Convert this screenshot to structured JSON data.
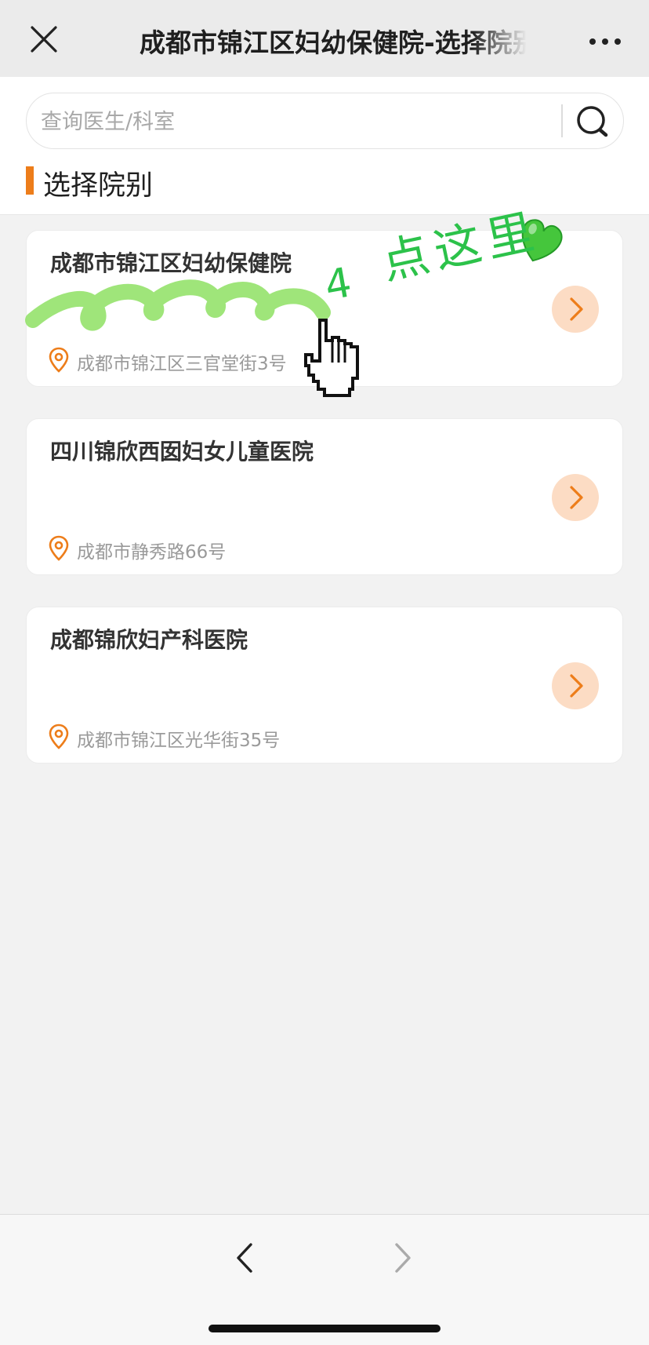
{
  "window": {
    "title": "成都市锦江区妇幼保健院-选择院别",
    "close_icon": "close-icon",
    "more_icon": "more-dots-icon"
  },
  "search": {
    "placeholder": "查询医生/科室",
    "value": "",
    "icon": "search-icon"
  },
  "section": {
    "title": "选择院别"
  },
  "hospitals": [
    {
      "name": "成都市锦江区妇幼保健院",
      "address": "成都市锦江区三官堂街3号"
    },
    {
      "name": "四川锦欣西囡妇女儿童医院",
      "address": "成都市静秀路66号"
    },
    {
      "name": "成都锦欣妇产科医院",
      "address": "成都市锦江区光华街35号"
    }
  ],
  "annotation": {
    "step_number": "4",
    "text": "点这里",
    "emoji": "💚",
    "color": "#2cc24a"
  },
  "bottom_nav": {
    "back_icon": "chevron-left-icon",
    "forward_icon": "chevron-right-icon"
  },
  "colors": {
    "accent": "#ed7d1a",
    "arrow_circle": "#fcdcc4",
    "highlight_scribble": "#95e26c"
  }
}
